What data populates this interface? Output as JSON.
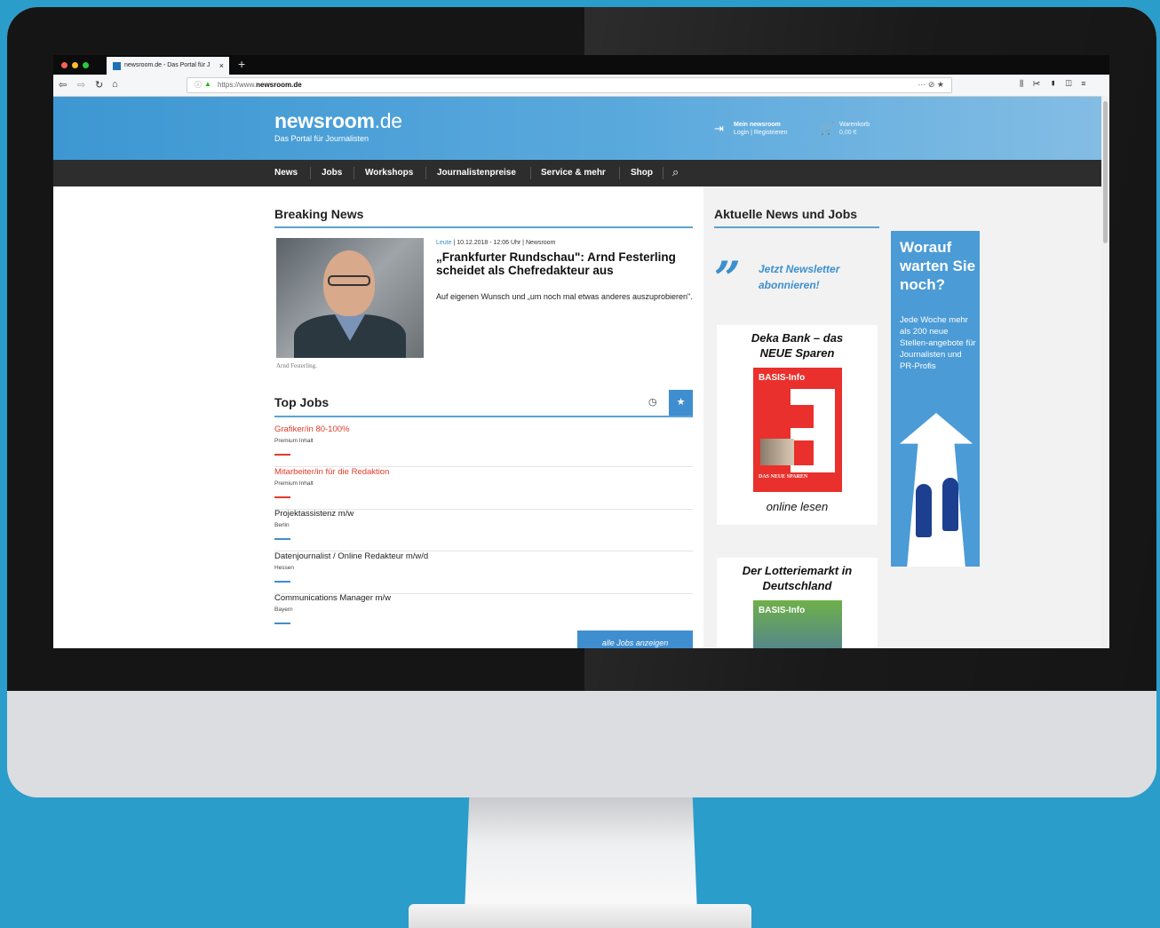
{
  "browser": {
    "tab_title": "newsroom.de - Das Portal für J",
    "tab_close": "×",
    "new_tab": "+",
    "url_prefix": "https://www.",
    "url_domain": "newsroom.de",
    "url_actions": "··· ⊘ ★",
    "right_icons": "⫼ ✂ ▮ ◫ ≡"
  },
  "site": {
    "logo_bold": "newsroom",
    "logo_light": ".de",
    "tagline": "Das Portal für Journalisten",
    "account_title": "Mein newsroom",
    "account_sub": "Login | Registrieren",
    "cart_title": "Warenkorb",
    "cart_sub": "0,00 €"
  },
  "nav": [
    "News",
    "Jobs",
    "Workshops",
    "Journalistenpreise",
    "Service & mehr",
    "Shop"
  ],
  "breaking": {
    "section_title": "Breaking News",
    "category": "Leute",
    "meta_rest": "  |  10.12.2018 - 12:06 Uhr  |  Newsroom",
    "headline": "„Frankfurter Rundschau\": Arnd Festerling scheidet als Chefredakteur aus",
    "teaser": "Auf eigenen Wunsch und „um noch mal etwas anderes auszuprobieren\".",
    "photo_caption": "Arnd Festerling."
  },
  "top_jobs": {
    "section_title": "Top Jobs",
    "all_jobs": "alle Jobs anzeigen",
    "items": [
      {
        "title": "Grafiker/in 80-100%",
        "sub": "Premium Inhalt",
        "color": "#e23b2b"
      },
      {
        "title": "Mitarbeiter/in für die Redaktion",
        "sub": "Premium Inhalt",
        "color": "#e23b2b"
      },
      {
        "title": "Projektassistenz m/w",
        "sub": "Berlin",
        "color": "#222222"
      },
      {
        "title": "Datenjournalist / Online Redakteur m/w/d",
        "sub": "Hessen",
        "color": "#222222"
      },
      {
        "title": "Communications Manager m/w",
        "sub": "Bayern",
        "color": "#222222"
      }
    ]
  },
  "sidebar": {
    "section_title": "Aktuelle News und Jobs",
    "newsletter_line1": "Jetzt Newsletter",
    "newsletter_line2": "abonnieren!",
    "ad1_title_line1": "Deka Bank – das",
    "ad1_title_line2": "NEUE Sparen",
    "ad1_book_title": "BASIS-Info",
    "ad1_book_footer": "DAS NEUE SPAREN",
    "ad1_cta": "online lesen",
    "ad2_title_line1": "Der Lotteriemarkt in",
    "ad2_title_line2": "Deutschland",
    "ad2_book_title": "BASIS-Info",
    "banner_headline": "Worauf warten Sie noch?",
    "banner_body": "Jede Woche mehr als 200 neue Stellen-angebote für Journalisten und PR-Profis"
  },
  "colors": {
    "accent": "#3f8ecf",
    "premium_job": "#e23b2b",
    "nav_bg": "#2d2d2d"
  }
}
